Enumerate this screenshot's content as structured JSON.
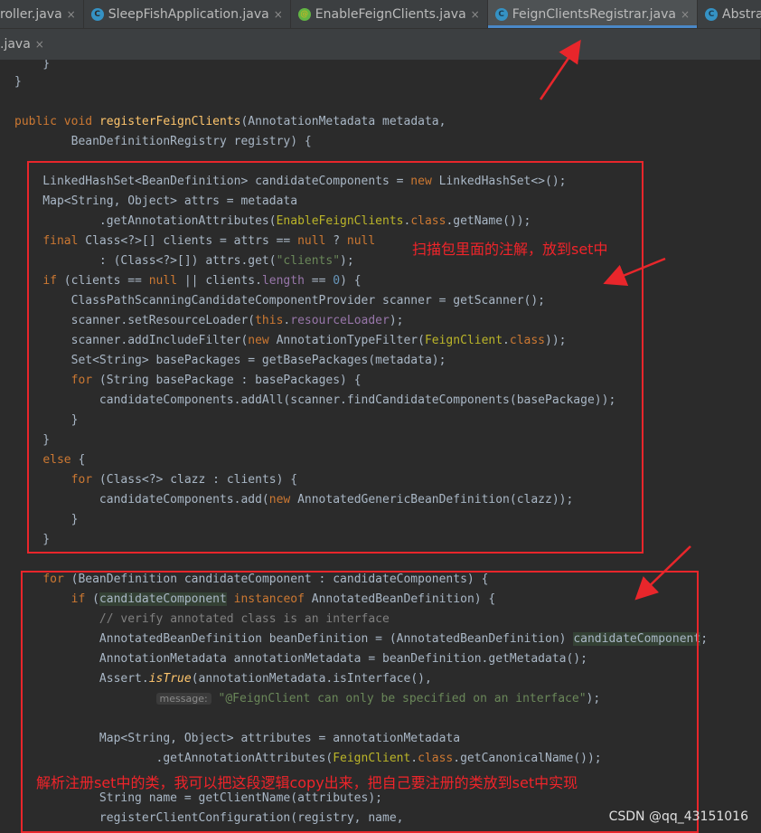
{
  "tabs": [
    {
      "label": "roller.java",
      "icon": "none"
    },
    {
      "label": "SleepFishApplication.java",
      "icon": "spring-app-icon"
    },
    {
      "label": "EnableFeignClients.java",
      "icon": "annotation-icon"
    },
    {
      "label": "FeignClientsRegistrar.java",
      "icon": "class-icon"
    },
    {
      "label": "Abstract",
      "icon": "class-icon"
    }
  ],
  "tab_close_glyph": "×",
  "second_row_tab": {
    "label": ".java"
  },
  "code": {
    "l01": "    }",
    "l02": "}",
    "l04_kw1": "public",
    "l04_kw2": "void",
    "l04_fn": "registerFeignClients",
    "l04_rest": "(AnnotationMetadata metadata,",
    "l05": "        BeanDefinitionRegistry registry) {",
    "l07_a": "    LinkedHashSet<BeanDefinition> candidateComponents = ",
    "l07_kw": "new",
    "l07_b": " LinkedHashSet<>();",
    "l08": "    Map<String, Object> attrs = metadata",
    "l09_a": "            .getAnnotationAttributes(",
    "l09_ann": "EnableFeignClients",
    "l09_b": ".",
    "l09_kw": "class",
    "l09_c": ".getName());",
    "l10_kw1": "final",
    "l10_a": " Class<?>[] clients = attrs == ",
    "l10_kw2": "null",
    "l10_b": " ? ",
    "l10_kw3": "null",
    "l11_a": "            : (Class<?>[]) attrs.get(",
    "l11_str": "\"clients\"",
    "l11_b": ");",
    "l12_kw1": "if",
    "l12_a": " (clients == ",
    "l12_kw2": "null",
    "l12_b": " || clients.",
    "l12_fld": "length",
    "l12_c": " == ",
    "l12_num": "0",
    "l12_d": ") {",
    "l13": "        ClassPathScanningCandidateComponentProvider scanner = getScanner();",
    "l14_a": "        scanner.setResourceLoader(",
    "l14_kw": "this",
    "l14_b": ".",
    "l14_fld": "resourceLoader",
    "l14_c": ");",
    "l15_a": "        scanner.addIncludeFilter(",
    "l15_kw1": "new",
    "l15_b": " AnnotationTypeFilter(",
    "l15_ann": "FeignClient",
    "l15_c": ".",
    "l15_kw2": "class",
    "l15_d": "));",
    "l16": "        Set<String> basePackages = getBasePackages(metadata);",
    "l17_kw": "for",
    "l17_a": " (String basePackage : basePackages) {",
    "l18": "            candidateComponents.addAll(scanner.findCandidateComponents(basePackage));",
    "l19": "        }",
    "l20": "    }",
    "l21_kw": "else",
    "l21_a": " {",
    "l22_kw": "for",
    "l22_a": " (Class<?> clazz : clients) {",
    "l23_a": "            candidateComponents.add(",
    "l23_kw": "new",
    "l23_b": " AnnotatedGenericBeanDefinition(clazz));",
    "l24": "        }",
    "l25": "    }",
    "l27_kw": "for",
    "l27_a": " (BeanDefinition candidateComponent : candidateComponents) {",
    "l28_kw1": "if",
    "l28_a": " (",
    "l28_hl": "candidateComponent",
    "l28_kw2": "instanceof",
    "l28_b": " AnnotatedBeanDefinition) {",
    "l29_cmt": "// verify annotated class is an interface",
    "l30_a": "            AnnotatedBeanDefinition beanDefinition = (AnnotatedBeanDefinition) ",
    "l30_hl": "candidateComponent",
    "l30_b": ";",
    "l31": "            AnnotationMetadata annotationMetadata = beanDefinition.getMetadata();",
    "l32_a": "            Assert.",
    "l32_it": "isTrue",
    "l32_b": "(annotationMetadata.isInterface(),",
    "l33_hint": "message:",
    "l33_str": "\"@FeignClient can only be specified on an interface\"",
    "l33_b": ");",
    "l35": "            Map<String, Object> attributes = annotationMetadata",
    "l36_a": "                    .getAnnotationAttributes(",
    "l36_ann": "FeignClient",
    "l36_b": ".",
    "l36_kw": "class",
    "l36_c": ".getCanonicalName());",
    "l38": "            String name = getClientName(attributes);",
    "l39": "            registerClientConfiguration(registry, name,"
  },
  "annotations": {
    "note1": "扫描包里面的注解，放到set中",
    "note2": "解析注册set中的类，我可以把这段逻辑copy出来，把自己要注册的类放到set中实现",
    "color": "#e8262b"
  },
  "watermark": "CSDN @qq_43151016",
  "colors": {
    "keyword": "#cc7832",
    "method": "#ffc66d",
    "string": "#6a8759",
    "number": "#6897bb",
    "annotation": "#bbb529",
    "field": "#9876aa",
    "comment": "#808080",
    "text": "#a9b7c6",
    "active_tab_underline": "#4a88c7"
  }
}
